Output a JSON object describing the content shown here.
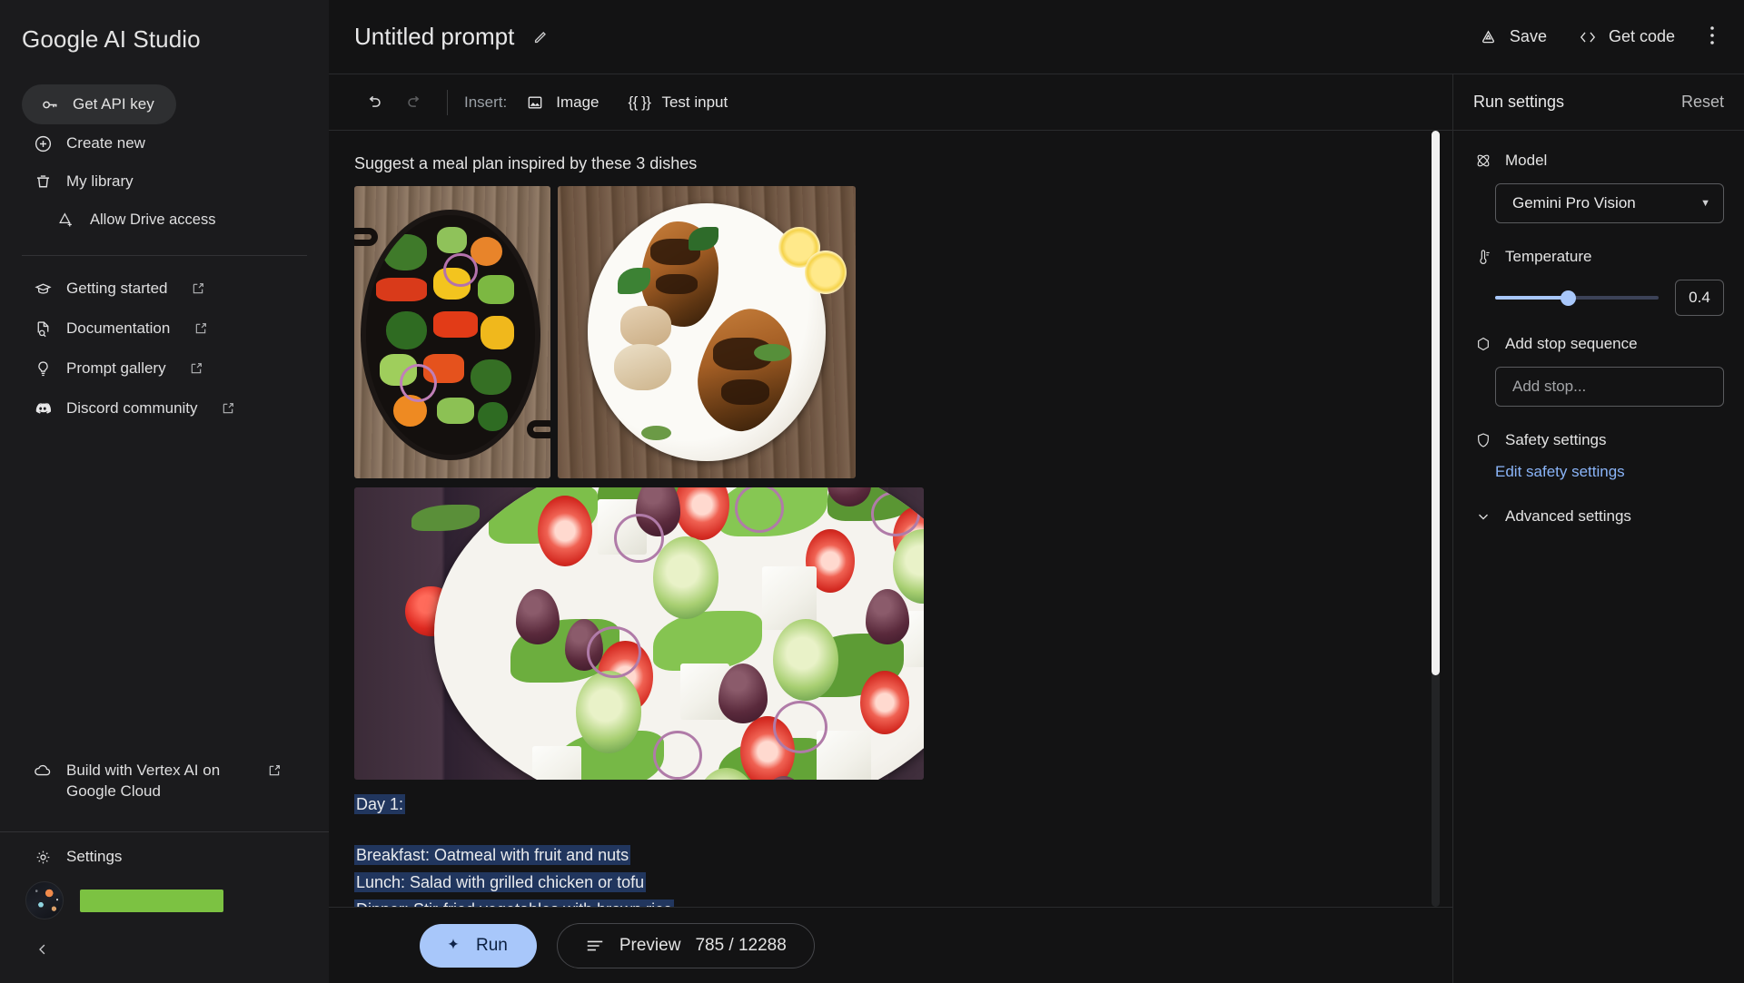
{
  "sidebar": {
    "brand": "Google AI Studio",
    "get_api_key": {
      "label": "Get API key",
      "icon": "key-icon"
    },
    "primary_items": [
      {
        "label": "Create new",
        "icon": "plus-circle-icon"
      },
      {
        "label": "My library",
        "icon": "library-icon"
      },
      {
        "label": "Allow Drive access",
        "icon": "drive-add-icon"
      }
    ],
    "link_items": [
      {
        "label": "Getting started",
        "icon": "graduation-cap-icon",
        "external": true
      },
      {
        "label": "Documentation",
        "icon": "document-search-icon",
        "external": true
      },
      {
        "label": "Prompt gallery",
        "icon": "lightbulb-icon",
        "external": true
      },
      {
        "label": "Discord community",
        "icon": "discord-icon",
        "external": true
      }
    ],
    "vertex": {
      "label": "Build with Vertex AI on Google Cloud",
      "icon": "cloud-icon",
      "external": true
    },
    "settings": {
      "label": "Settings",
      "icon": "gear-icon"
    },
    "account": {
      "redacted": true
    },
    "collapse": {
      "icon": "chevron-left-icon"
    }
  },
  "header": {
    "title": "Untitled prompt",
    "edit_icon": "pencil-icon",
    "save_label": "Save",
    "save_icon": "save-drive-icon",
    "get_code_label": "Get code",
    "get_code_icon": "code-brackets-icon",
    "more_icon": "kebab-menu-icon"
  },
  "toolbar": {
    "undo_icon": "undo-icon",
    "redo_icon": "redo-icon",
    "insert_label": "Insert:",
    "image_label": "Image",
    "image_icon": "image-icon",
    "test_input_label": "Test input",
    "test_input_icon": "{{ }}"
  },
  "prompt": {
    "text": "Suggest a meal plan inspired by these 3 dishes",
    "images": [
      {
        "alt": "stir-fried vegetables in a cast iron skillet"
      },
      {
        "alt": "grilled chicken breasts on a white plate with lemon"
      },
      {
        "alt": "greek salad with feta, olives, tomato and cucumber"
      }
    ],
    "response_lines": [
      "Day 1:",
      "",
      "Breakfast: Oatmeal with fruit and nuts",
      "Lunch: Salad with grilled chicken or tofu",
      "Dinner: Stir-fried vegetables with brown rice"
    ],
    "selection_color": "#21365e"
  },
  "bottombar": {
    "run_label": "Run",
    "run_icon": "sparkle-icon",
    "preview_label": "Preview",
    "preview_icon": "lines-icon",
    "token_count": "785 / 12288",
    "run_bg": "#a8c7fa"
  },
  "run_settings": {
    "title": "Run settings",
    "reset_label": "Reset",
    "model": {
      "label": "Model",
      "icon": "model-atom-icon",
      "value": "Gemini Pro Vision",
      "caret": "▼"
    },
    "temperature": {
      "label": "Temperature",
      "icon": "thermometer-icon",
      "value": "0.4",
      "min": 0,
      "max": 1
    },
    "stop_sequence": {
      "label": "Add stop sequence",
      "icon": "hexagon-icon",
      "placeholder": "Add stop..."
    },
    "safety": {
      "label": "Safety settings",
      "icon": "shield-icon",
      "link": "Edit safety settings",
      "link_color": "#8ab4f8"
    },
    "advanced": {
      "label": "Advanced settings",
      "icon": "chevron-down-icon"
    }
  }
}
